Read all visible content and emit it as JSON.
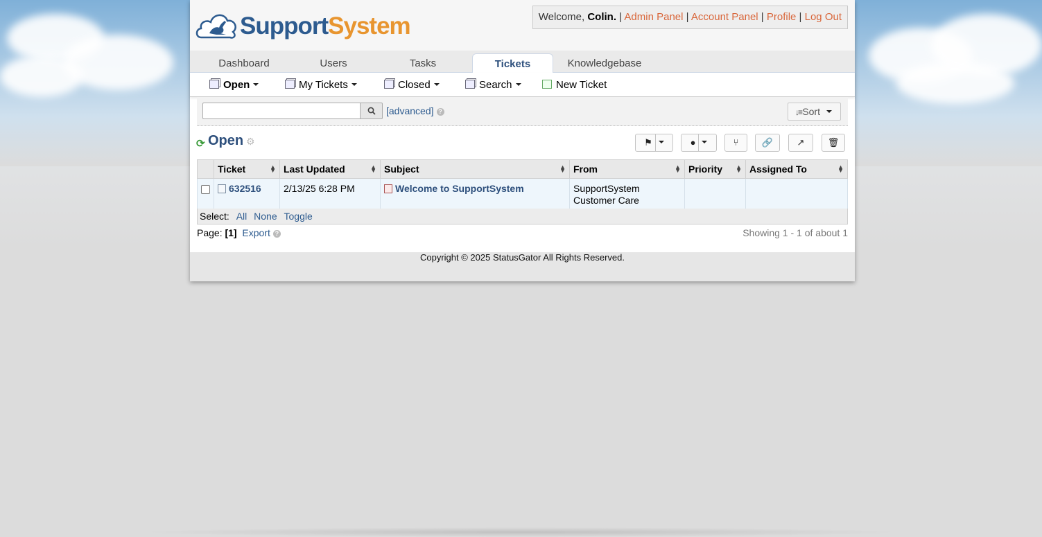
{
  "header": {
    "logo_part1": "Support",
    "logo_part2": "System",
    "welcome_prefix": "Welcome,",
    "user_name": "Colin.",
    "links": [
      "Admin Panel",
      "Account Panel",
      "Profile",
      "Log Out"
    ]
  },
  "tabs": [
    {
      "label": "Dashboard",
      "active": false
    },
    {
      "label": "Users",
      "active": false
    },
    {
      "label": "Tasks",
      "active": false
    },
    {
      "label": "Tickets",
      "active": true
    },
    {
      "label": "Knowledgebase",
      "active": false
    }
  ],
  "subnav": {
    "open": "Open",
    "my_tickets": "My Tickets",
    "closed": "Closed",
    "search": "Search",
    "new_ticket": "New Ticket"
  },
  "search": {
    "value": "",
    "advanced": "[advanced]",
    "sort_label": "Sort"
  },
  "queue": {
    "title": "Open"
  },
  "table": {
    "headers": [
      "Ticket",
      "Last Updated",
      "Subject",
      "From",
      "Priority",
      "Assigned To"
    ],
    "rows": [
      {
        "ticket": "632516",
        "last_updated": "2/13/25 6:28 PM",
        "subject": "Welcome to SupportSystem",
        "from_line1": "SupportSystem",
        "from_line2": "Customer Care",
        "priority": "",
        "assigned_to": ""
      }
    ]
  },
  "select": {
    "label": "Select:",
    "all": "All",
    "none": "None",
    "toggle": "Toggle"
  },
  "pagination": {
    "label": "Page:",
    "current": "[1]",
    "export": "Export",
    "showing": "Showing 1 - 1 of about 1"
  },
  "footer": {
    "copyright": "Copyright © 2025 StatusGator All Rights Reserved."
  },
  "colors": {
    "accent": "#2d4f7c",
    "link_orange": "#d9663a",
    "logo_blue": "#2d5b8f",
    "logo_orange": "#e8952f"
  }
}
